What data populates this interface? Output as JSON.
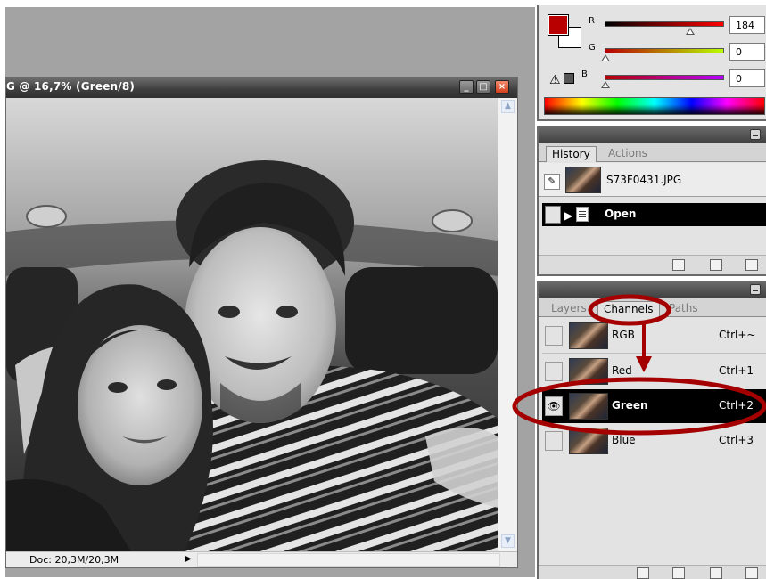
{
  "document": {
    "title": "G @ 16,7% (Green/8)",
    "status_doc_size": "Doc: 20,3M/20,3M",
    "window_buttons": {
      "minimize": "_",
      "maximize": "□",
      "close": "×"
    }
  },
  "color_panel": {
    "foreground_color": "#b80000",
    "background_color": "#ffffff",
    "channels": [
      {
        "letter": "R",
        "value": "184",
        "level": 0.72
      },
      {
        "letter": "G",
        "value": "0",
        "level": 0.0
      },
      {
        "letter": "B",
        "value": "0",
        "level": 0.0
      }
    ]
  },
  "history_panel": {
    "tabs": [
      "History",
      "Actions"
    ],
    "snapshot_name": "S73F0431.JPG",
    "steps": [
      {
        "label": "Open"
      }
    ]
  },
  "channels_panel": {
    "tabs": [
      "Layers",
      "Channels",
      "Paths"
    ],
    "rows": [
      {
        "name": "RGB",
        "shortcut": "Ctrl+~"
      },
      {
        "name": "Red",
        "shortcut": "Ctrl+1"
      },
      {
        "name": "Green",
        "shortcut": "Ctrl+2"
      },
      {
        "name": "Blue",
        "shortcut": "Ctrl+3"
      }
    ]
  },
  "colors": {
    "annotation_red": "#a50000",
    "panel_bar": "#4a4a4a",
    "selected_row": "#000000"
  }
}
